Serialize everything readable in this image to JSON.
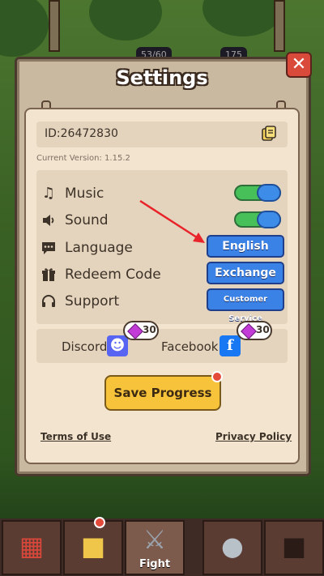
{
  "hud": {
    "counter": "53/60",
    "resource": "175"
  },
  "dialog": {
    "title": "Settings",
    "player_id": "ID:26472830",
    "version": "Current Version: 1.15.2",
    "options": [
      {
        "icon": "music-note-icon",
        "label": "Music",
        "control": "toggle",
        "state": "on"
      },
      {
        "icon": "speaker-icon",
        "label": "Sound",
        "control": "toggle",
        "state": "on"
      },
      {
        "icon": "chat-icon",
        "label": "Language",
        "control": "button",
        "button_label": "English"
      },
      {
        "icon": "gift-icon",
        "label": "Redeem Code",
        "control": "button",
        "button_label": "Exchange"
      },
      {
        "icon": "headset-icon",
        "label": "Support",
        "control": "button",
        "button_label": "Customer Service"
      }
    ],
    "social": {
      "discord_label": "Discord",
      "discord_reward": "30",
      "facebook_label": "Facebook",
      "facebook_reward": "30"
    },
    "save_label": "Save Progress",
    "terms_label": "Terms of Use",
    "privacy_label": "Privacy Policy"
  },
  "bottom_nav": [
    {
      "icon": "shop-icon",
      "label": ""
    },
    {
      "icon": "cards-icon",
      "label": ""
    },
    {
      "icon": "crossed-swords-icon",
      "label": "Fight"
    },
    {
      "icon": "helmet-icon",
      "label": ""
    },
    {
      "icon": "lock-icon",
      "label": ""
    }
  ],
  "colors": {
    "toggle_on": "#48c05a",
    "button_blue": "#3b82e6",
    "save_yellow": "#f6c33a",
    "close_red": "#d94a3b",
    "annotation_arrow": "#e8232a"
  }
}
